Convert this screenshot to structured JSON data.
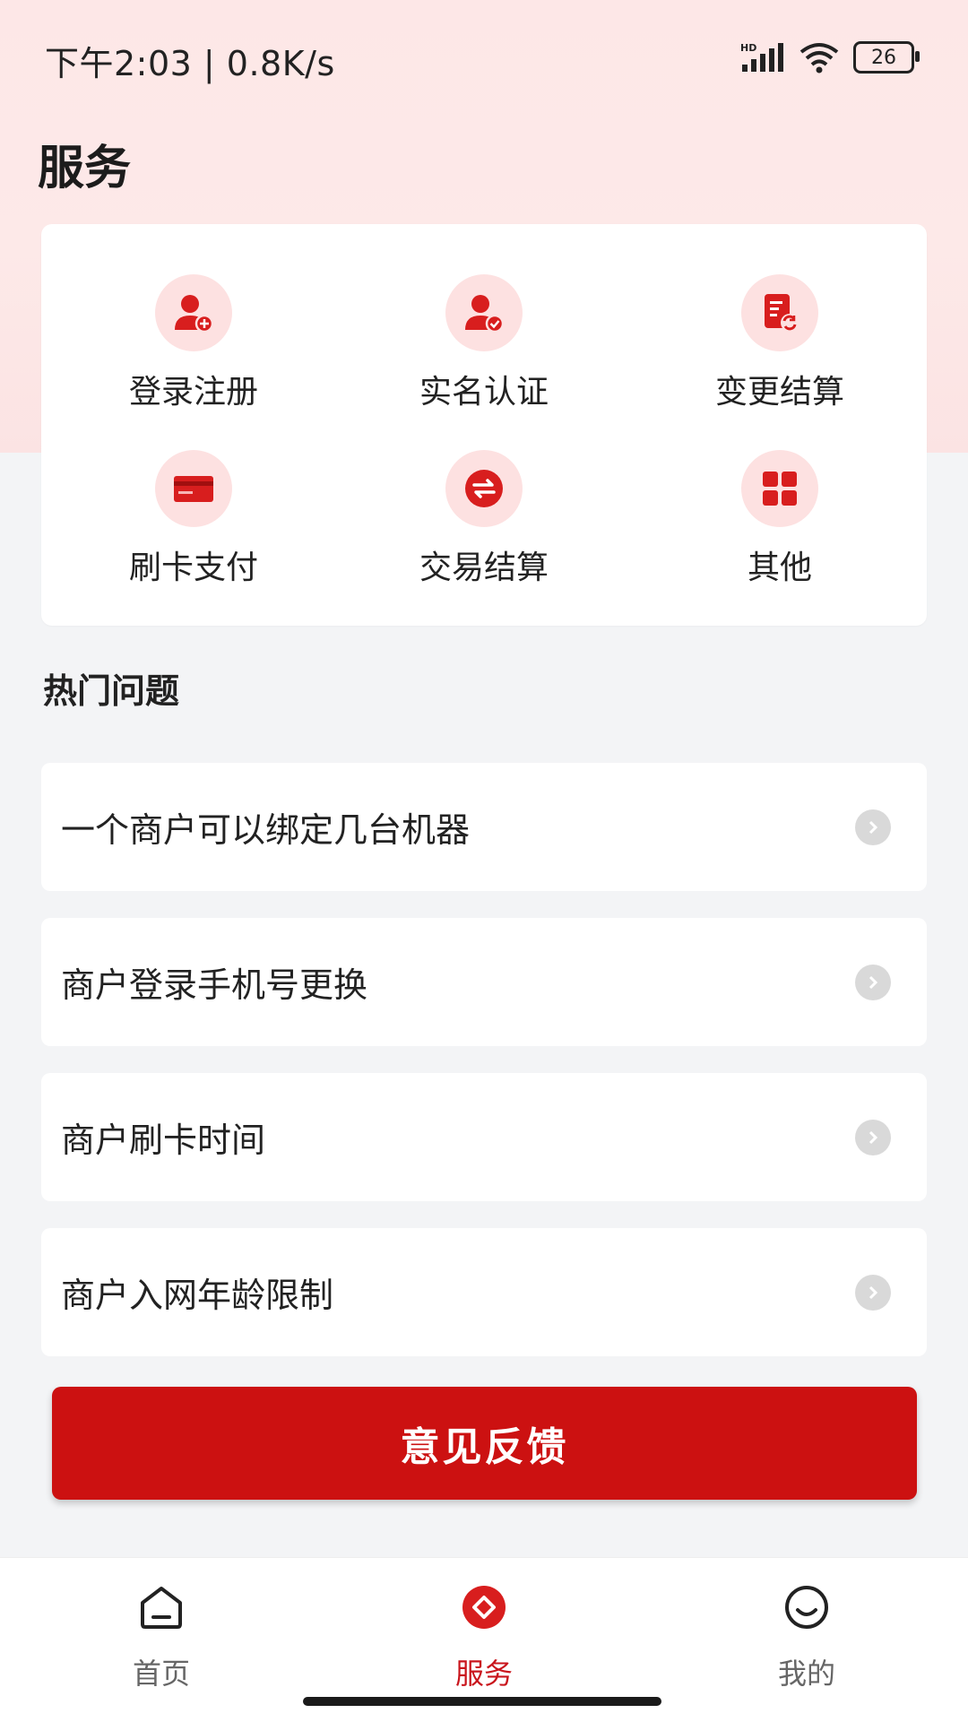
{
  "status": {
    "time": "下午2:03 | 0.8K/s",
    "network_label": "HD",
    "battery": "26"
  },
  "page": {
    "title": "服务"
  },
  "services": [
    {
      "label": "登录注册",
      "icon": "user-add-icon"
    },
    {
      "label": "实名认证",
      "icon": "user-verified-icon"
    },
    {
      "label": "变更结算",
      "icon": "settlement-change-icon"
    },
    {
      "label": "刷卡支付",
      "icon": "card-payment-icon"
    },
    {
      "label": "交易结算",
      "icon": "exchange-icon"
    },
    {
      "label": "其他",
      "icon": "grid-icon"
    }
  ],
  "hot_questions": {
    "title": "热门问题",
    "items": [
      "一个商户可以绑定几台机器",
      "商户登录手机号更换",
      "商户刷卡时间",
      "商户入网年龄限制"
    ]
  },
  "feedback": {
    "label": "意见反馈"
  },
  "tabbar": {
    "items": [
      {
        "label": "首页",
        "icon": "home-icon",
        "active": false
      },
      {
        "label": "服务",
        "icon": "service-diamond-icon",
        "active": true
      },
      {
        "label": "我的",
        "icon": "smile-icon",
        "active": false
      }
    ]
  },
  "colors": {
    "accent": "#cc1111",
    "icon_bg": "#fde1e1",
    "page_bg": "#f3f4f6"
  }
}
